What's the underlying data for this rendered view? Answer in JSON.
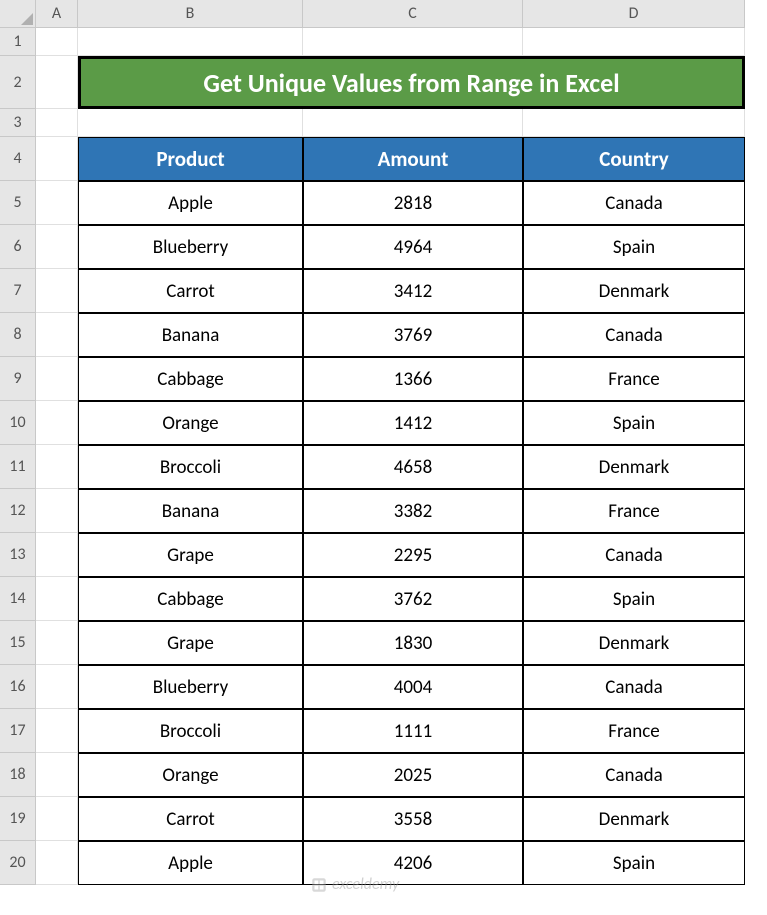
{
  "columns": [
    "A",
    "B",
    "C",
    "D"
  ],
  "row_numbers": [
    1,
    2,
    3,
    4,
    5,
    6,
    7,
    8,
    9,
    10,
    11,
    12,
    13,
    14,
    15,
    16,
    17,
    18,
    19,
    20
  ],
  "title": "Get Unique Values from Range in Excel",
  "headers": [
    "Product",
    "Amount",
    "Country"
  ],
  "chart_data": {
    "type": "table",
    "title": "Get Unique Values from Range in Excel",
    "columns": [
      "Product",
      "Amount",
      "Country"
    ],
    "rows": [
      [
        "Apple",
        2818,
        "Canada"
      ],
      [
        "Blueberry",
        4964,
        "Spain"
      ],
      [
        "Carrot",
        3412,
        "Denmark"
      ],
      [
        "Banana",
        3769,
        "Canada"
      ],
      [
        "Cabbage",
        1366,
        "France"
      ],
      [
        "Orange",
        1412,
        "Spain"
      ],
      [
        "Broccoli",
        4658,
        "Denmark"
      ],
      [
        "Banana",
        3382,
        "France"
      ],
      [
        "Grape",
        2295,
        "Canada"
      ],
      [
        "Cabbage",
        3762,
        "Spain"
      ],
      [
        "Grape",
        1830,
        "Denmark"
      ],
      [
        "Blueberry",
        4004,
        "Canada"
      ],
      [
        "Broccoli",
        1111,
        "France"
      ],
      [
        "Orange",
        2025,
        "Canada"
      ],
      [
        "Carrot",
        3558,
        "Denmark"
      ],
      [
        "Apple",
        4206,
        "Spain"
      ]
    ]
  },
  "watermark": "exceldemy"
}
